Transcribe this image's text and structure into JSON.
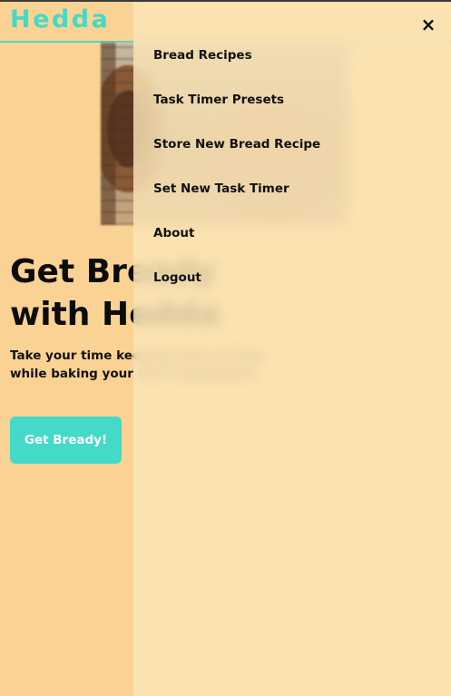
{
  "brand": {
    "logo_text": "Hedda",
    "accent": "#45d9c8",
    "background": "#fad394"
  },
  "hero": {
    "title": "Get Bready with Hedda",
    "subtitle": "Take your time keeping track of time while baking your next masterpiece",
    "cta_label": "Get Bready!"
  },
  "menu": {
    "close_icon": "×",
    "items": [
      {
        "label": "Bread Recipes"
      },
      {
        "label": "Task Timer Presets"
      },
      {
        "label": "Store New Bread Recipe"
      },
      {
        "label": "Set New Task Timer"
      },
      {
        "label": "About"
      },
      {
        "label": "Logout"
      }
    ]
  }
}
